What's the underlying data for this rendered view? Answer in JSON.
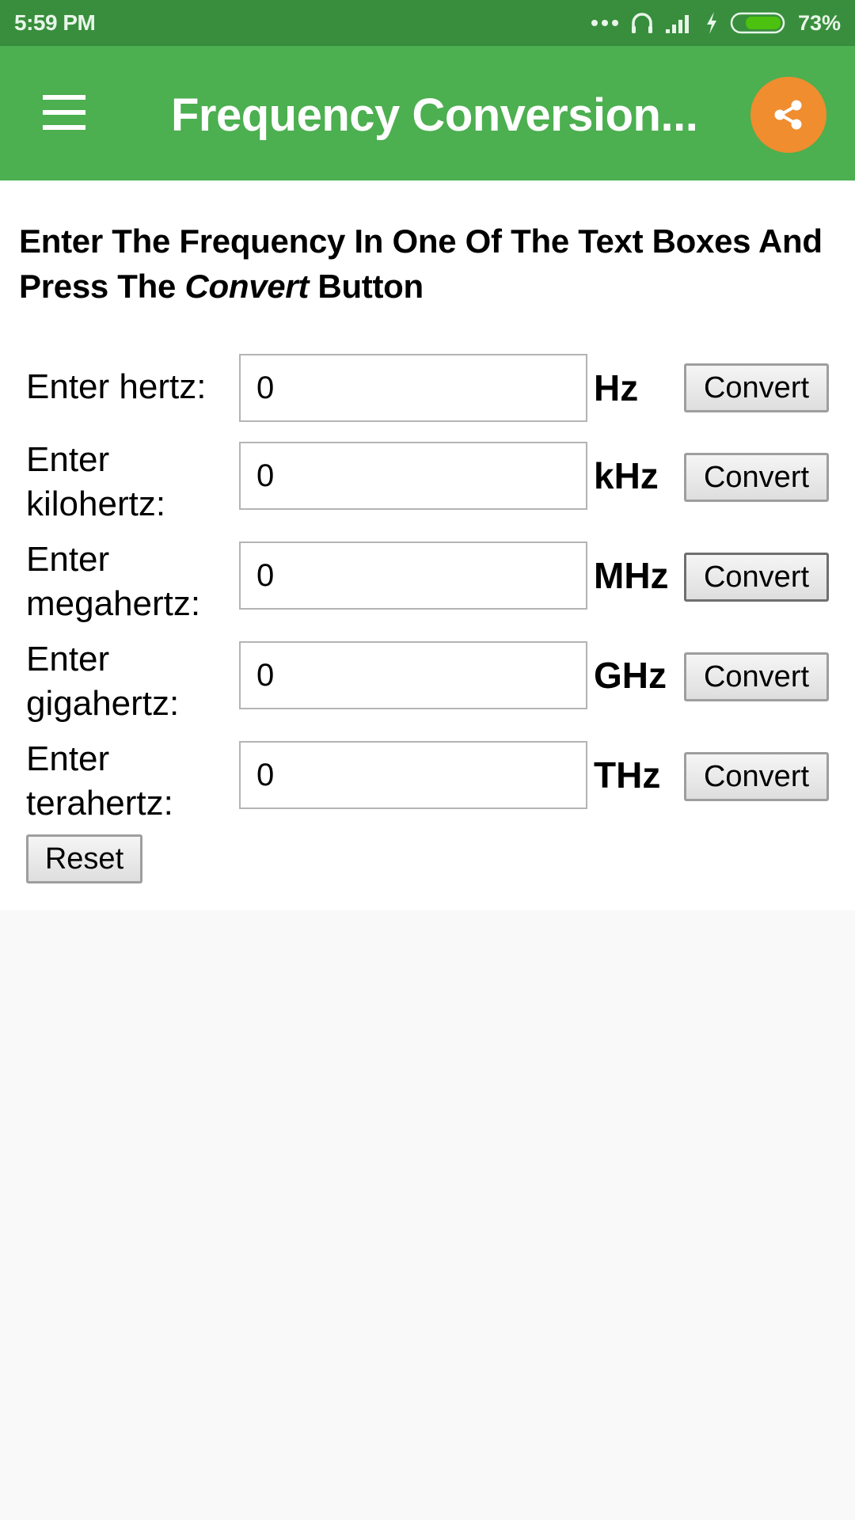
{
  "status_bar": {
    "time": "5:59 PM",
    "icons": [
      "more-notifications-icon",
      "headphones-icon",
      "signal-icon",
      "charging-icon",
      "battery-icon"
    ],
    "battery_percent": "73%",
    "battery_level": 0.73
  },
  "app_bar": {
    "menu_icon": "hamburger-menu-icon",
    "title": "Frequency Conversion...",
    "share_icon": "share-icon",
    "share_color": "#ef8d2f",
    "bar_color": "#4caf50"
  },
  "main": {
    "instruction_part1": "Enter The Frequency In One Of The Text Boxes And Press The ",
    "instruction_emphasis": "Convert",
    "instruction_part2": " Button",
    "rows": [
      {
        "label_line1": "Enter hertz:",
        "label_line2": "",
        "value": "0",
        "unit": "Hz",
        "button": "Convert"
      },
      {
        "label_line1": "Enter",
        "label_line2": "kilohertz:",
        "value": "0",
        "unit": "kHz",
        "button": "Convert"
      },
      {
        "label_line1": "Enter",
        "label_line2": "megahertz:",
        "value": "0",
        "unit": "MHz",
        "button": "Convert"
      },
      {
        "label_line1": "Enter",
        "label_line2": "gigahertz:",
        "value": "0",
        "unit": "GHz",
        "button": "Convert"
      },
      {
        "label_line1": "Enter",
        "label_line2": "terahertz:",
        "value": "0",
        "unit": "THz",
        "button": "Convert"
      }
    ],
    "reset_button": "Reset"
  }
}
